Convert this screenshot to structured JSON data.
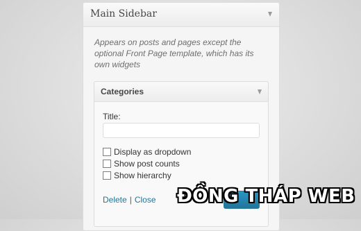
{
  "sidebar": {
    "title": "Main Sidebar",
    "description": "Appears on posts and pages except the optional Front Page template, which has its own widgets"
  },
  "widget": {
    "title": "Categories",
    "title_field_label": "Title:",
    "title_field_value": "",
    "options": [
      {
        "label": "Display as dropdown",
        "checked": false
      },
      {
        "label": "Show post counts",
        "checked": false
      },
      {
        "label": "Show hierarchy",
        "checked": false
      }
    ],
    "delete_label": "Delete",
    "separator": "|",
    "close_label": "Close",
    "save_label": ""
  },
  "watermark": "ĐỒNG THÁP WEB",
  "colors": {
    "link": "#21759b",
    "save_button": "#21759b",
    "panel_background": "#f5f5f5"
  },
  "icons": {
    "sidebar_toggle": "triangle-down-icon",
    "widget_toggle": "triangle-down-icon"
  }
}
